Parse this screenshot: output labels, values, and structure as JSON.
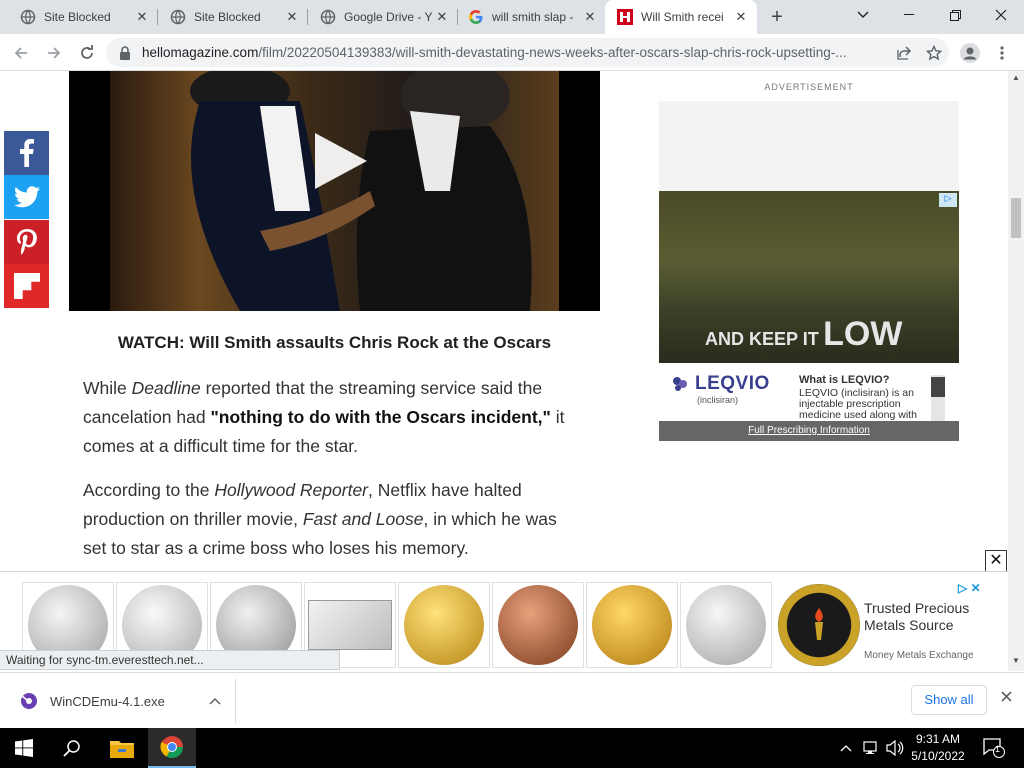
{
  "browser": {
    "tabs": [
      {
        "title": "Site Blocked",
        "favicon": "globe-icon"
      },
      {
        "title": "Site Blocked",
        "favicon": "globe-icon"
      },
      {
        "title": "Google Drive - Y",
        "favicon": "globe-icon"
      },
      {
        "title": "will smith slap -",
        "favicon": "google-icon"
      },
      {
        "title": "Will Smith recei",
        "favicon": "hello-icon",
        "active": true
      }
    ],
    "url_host": "hellomagazine.com",
    "url_path": "/film/20220504139383/will-smith-devastating-news-weeks-after-oscars-slap-chris-rock-upsetting-..."
  },
  "article": {
    "caption": "WATCH: Will Smith assaults Chris Rock at the Oscars",
    "para1": {
      "t1": "While ",
      "em1": "Deadline",
      "t2": " reported that the streaming service said the cancelation had ",
      "bold": "\"nothing to do with the Oscars incident,\"",
      "t3": " it comes at a difficult time for the star."
    },
    "para2": {
      "t1": "According to the ",
      "em1": "Hollywood Reporter",
      "t2": ", Netflix have halted production on thriller movie, ",
      "em2": "Fast and Loose",
      "t3": ", in which he was set to star as a crime boss who loses his memory."
    },
    "share": [
      {
        "name": "facebook",
        "color": "#3b5998"
      },
      {
        "name": "twitter",
        "color": "#1da1f2"
      },
      {
        "name": "pinterest",
        "color": "#cb2027"
      },
      {
        "name": "flipboard",
        "color": "#e12828"
      }
    ]
  },
  "side_ad": {
    "label": "ADVERTISEMENT",
    "slogan_small": "AND KEEP IT",
    "slogan_big": "LOW",
    "brand": "LEQVIO",
    "brand_sub": "(inclisiran)",
    "question": "What is LEQVIO?",
    "body": "LEQVIO (inclisiran) is an injectable prescription medicine used along with",
    "footer_link": "Full Prescribing Information"
  },
  "sticky_ad": {
    "headline": "Trusted Precious Metals Source",
    "advertiser": "Money Metals Exchange",
    "coin_colors": [
      "#c9c9c9",
      "#d5d5d5",
      "#c4c4c4",
      "#eaeaea",
      "#d9a62a",
      "#b06a3c",
      "#e0a62d",
      "#cfcfcf"
    ]
  },
  "status_text": "Waiting for sync-tm.everesttech.net...",
  "downloads": {
    "file_name": "WinCDEmu-4.1.exe",
    "show_all": "Show all"
  },
  "taskbar": {
    "time": "9:31 AM",
    "date": "5/10/2022",
    "notification_count": "1"
  }
}
